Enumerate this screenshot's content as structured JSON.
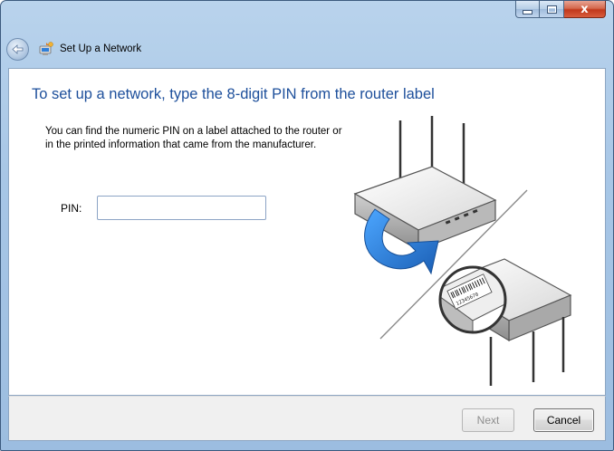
{
  "window": {
    "title": "Set Up a Network",
    "close_glyph": "x"
  },
  "page": {
    "heading": "To set up a network, type the 8-digit PIN from the router label",
    "description": "You can find the numeric PIN on a label attached to the router or in the printed information that came from the manufacturer.",
    "pin": {
      "label": "PIN:",
      "value": "",
      "placeholder": ""
    }
  },
  "footer": {
    "next_label": "Next",
    "cancel_label": "Cancel"
  },
  "illustration": {
    "label_code": "12345670"
  },
  "colors": {
    "heading": "#1d4f9b",
    "titlebar": "#b9d3ec",
    "arrow": "#2f7fd9"
  },
  "icons": [
    "back-arrow-icon",
    "network-wizard-icon",
    "minimize-icon",
    "maximize-icon",
    "close-icon"
  ]
}
